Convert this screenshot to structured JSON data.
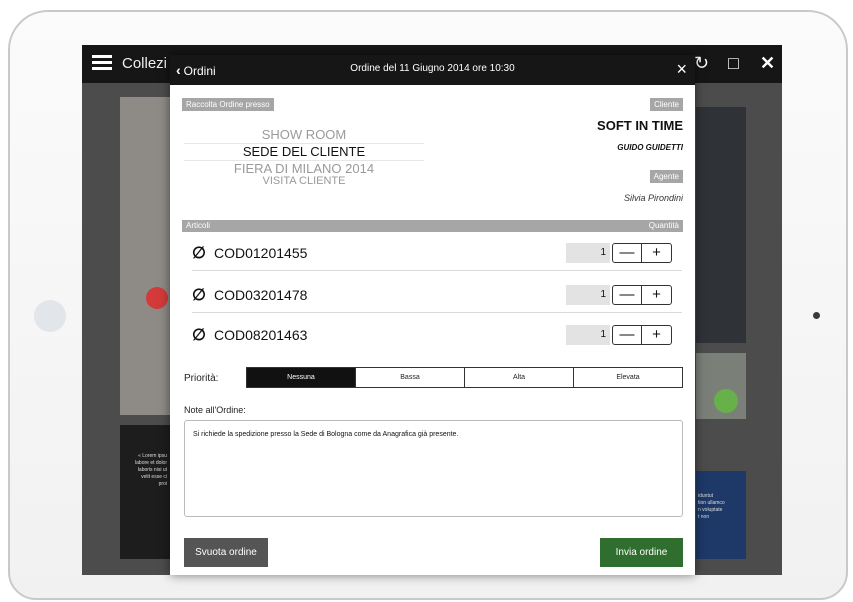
{
  "app_bar": {
    "title": "Collezi"
  },
  "background": {
    "left_text": "« Lorem ipsu\nlabore et dolor\nlaboris nisi ut\nvelit esse ci\nproi",
    "right_text": "iduntut\ntion ullamco\nn voluptate\nt non"
  },
  "modal": {
    "back_label": "Ordini",
    "title": "Ordine del 11 Giugno 2014 ore 10:30",
    "close_icon": "×"
  },
  "collection": {
    "header": "Raccolta Ordine presso",
    "locations": [
      "SHOW ROOM",
      "SEDE DEL CLIENTE",
      "FIERA DI MILANO 2014",
      "VISITA CLIENTE"
    ],
    "selected": "SEDE DEL CLIENTE"
  },
  "client": {
    "header": "Cliente",
    "name": "SOFT IN TIME",
    "contact": "GUIDO GUIDETTI"
  },
  "agent": {
    "header": "Agente",
    "name": "Silvia Pirondini"
  },
  "articles": {
    "header": "Articoli",
    "qty_header": "Quantità",
    "items": [
      {
        "code": "COD01201455",
        "qty": "1"
      },
      {
        "code": "COD03201478",
        "qty": "1"
      },
      {
        "code": "COD08201463",
        "qty": "1"
      }
    ],
    "minus": "—",
    "plus": "+"
  },
  "priority": {
    "label": "Priorità:",
    "options": [
      "Nessuna",
      "Bassa",
      "Alta",
      "Elevata"
    ],
    "selected": "Nessuna"
  },
  "notes": {
    "label": "Note all'Ordine:",
    "value": "Si richiede la spedizione presso la Sede di Bologna come da Anagrafica già presente."
  },
  "buttons": {
    "clear": "Svuota ordine",
    "send": "Invia ordine"
  },
  "colors": {
    "header_bg": "#161616",
    "send_button": "#2f6e2e",
    "clear_button": "#555555",
    "tag_bg": "#a6a6a6"
  }
}
